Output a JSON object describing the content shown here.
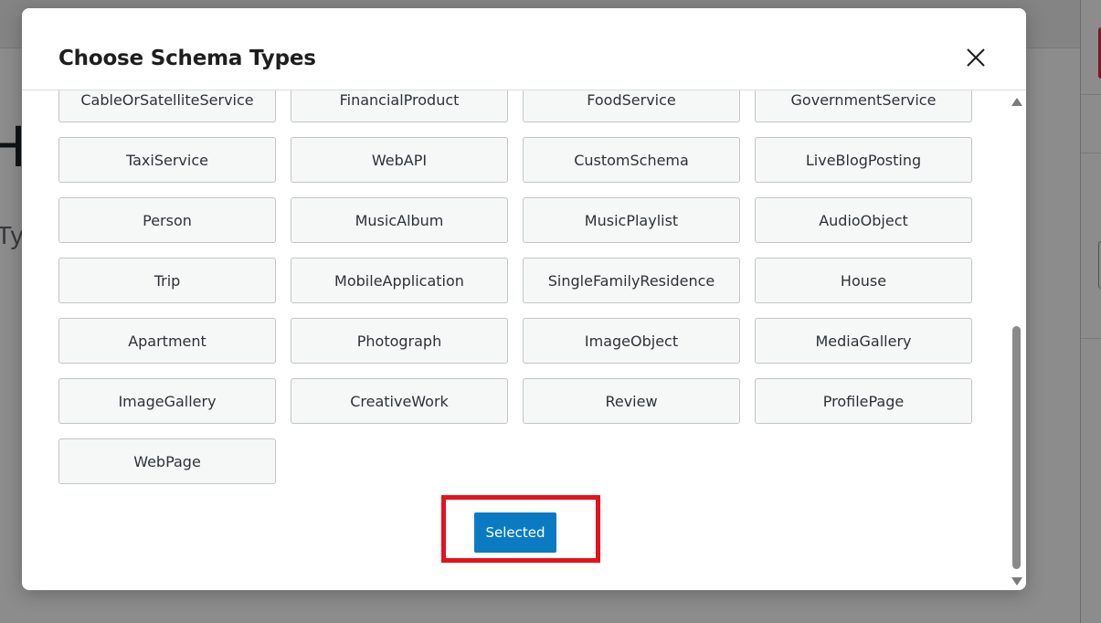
{
  "modal": {
    "title": "Choose Schema Types",
    "selected_label": "Selected"
  },
  "schema_types": [
    "CableOrSatelliteService",
    "FinancialProduct",
    "FoodService",
    "GovernmentService",
    "TaxiService",
    "WebAPI",
    "CustomSchema",
    "LiveBlogPosting",
    "Person",
    "MusicAlbum",
    "MusicPlaylist",
    "AudioObject",
    "Trip",
    "MobileApplication",
    "SingleFamilyResidence",
    "House",
    "Apartment",
    "Photograph",
    "ImageObject",
    "MediaGallery",
    "ImageGallery",
    "CreativeWork",
    "Review",
    "ProfilePage",
    "WebPage"
  ],
  "colors": {
    "primary_button": "#0a7bc2",
    "highlight_border": "#e5121b",
    "option_background": "#f6f7f7",
    "option_border": "#c3c4c7"
  },
  "background": {
    "heading": "H",
    "subtext": "Ty"
  },
  "icons": {
    "close": "close-icon",
    "scroll_up": "scroll-up-arrow-icon",
    "scroll_down": "scroll-down-arrow-icon"
  }
}
